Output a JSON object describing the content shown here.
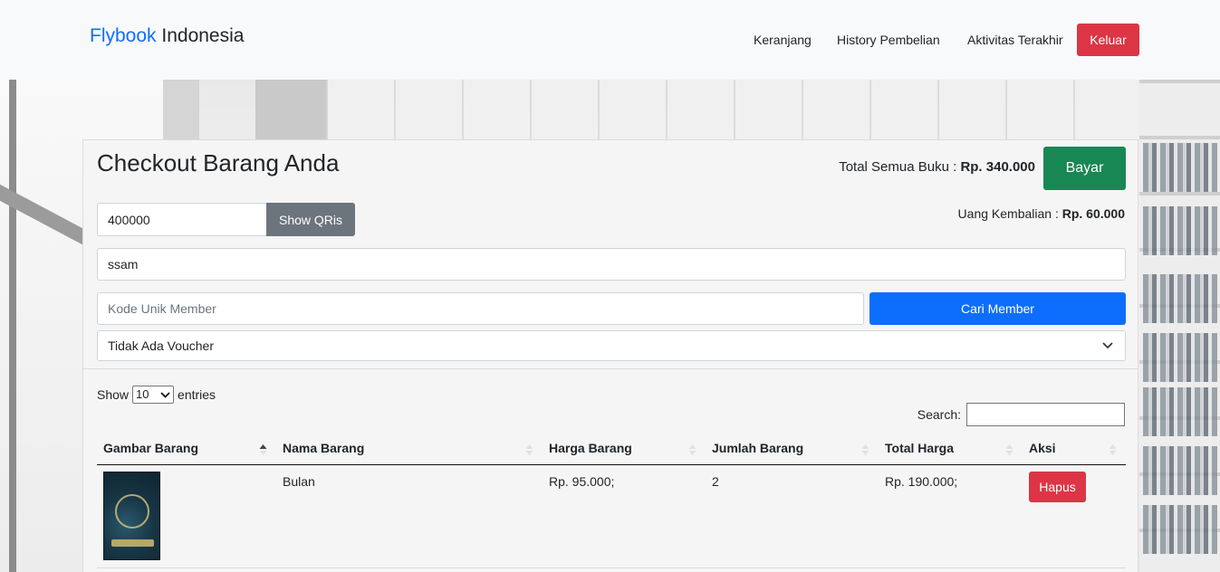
{
  "navbar": {
    "brand_part1": "Flybook",
    "brand_part2": "Indonesia",
    "links": [
      "Keranjang",
      "History Pembelian",
      "Aktivitas Terakhir"
    ],
    "logout_label": "Keluar"
  },
  "checkout": {
    "title": "Checkout Barang Anda",
    "total_label": "Total Semua Buku :",
    "total_value": "Rp. 340.000",
    "pay_label": "Bayar",
    "change_label": "Uang Kembalian :",
    "change_value": "Rp. 60.000",
    "payment_amount": "400000",
    "qris_label": "Show QRis",
    "customer_name": "ssam",
    "member_code_placeholder": "Kode Unik Member",
    "find_member_label": "Cari Member",
    "voucher_selected": "Tidak Ada Voucher"
  },
  "table_controls": {
    "show_label": "Show",
    "entries_value": "10",
    "entries_label": "entries",
    "search_label": "Search:"
  },
  "table": {
    "headers": [
      "Gambar Barang",
      "Nama Barang",
      "Harga Barang",
      "Jumlah Barang",
      "Total Harga",
      "Aksi"
    ],
    "rows": [
      {
        "image": "book-cover",
        "name": "Bulan",
        "price": "Rp. 95.000;",
        "quantity": "2",
        "total": "Rp. 190.000;",
        "action_label": "Hapus"
      }
    ]
  },
  "colors": {
    "brand_blue": "#0d6efd",
    "danger": "#dc3545",
    "success": "#198754",
    "secondary": "#6c757d"
  }
}
